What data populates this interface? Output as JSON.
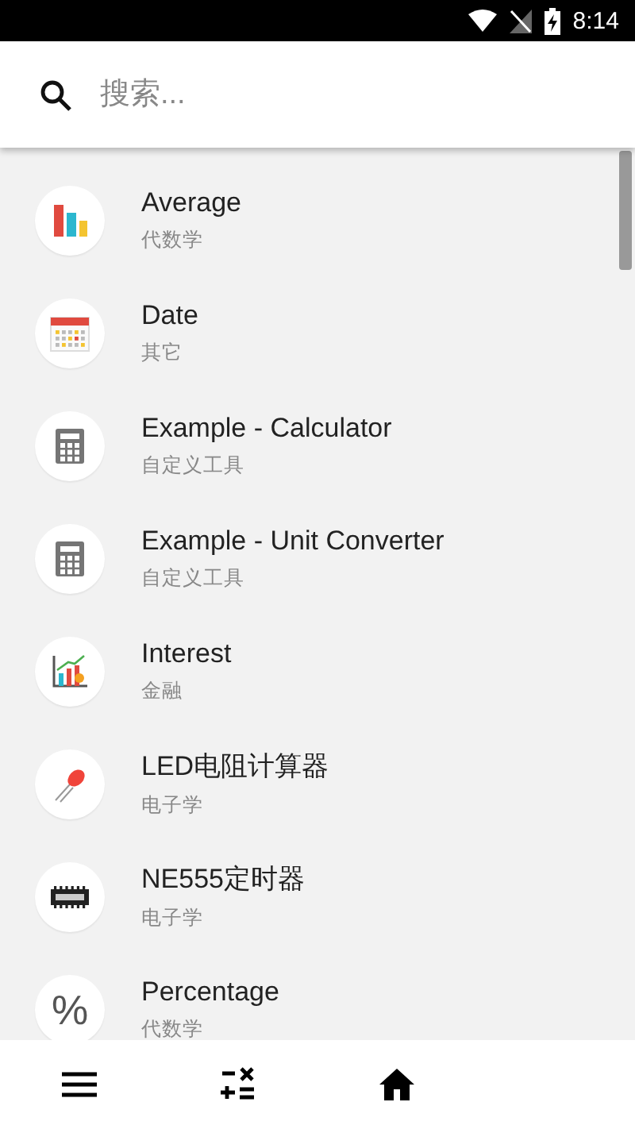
{
  "status_bar": {
    "time": "8:14"
  },
  "search": {
    "placeholder": "搜索..."
  },
  "items": [
    {
      "title": "Average",
      "category": "代数学",
      "kind": "bars"
    },
    {
      "title": "Date",
      "category": "其它",
      "kind": "calendar"
    },
    {
      "title": "Example - Calculator",
      "category": "自定义工具",
      "kind": "calculator"
    },
    {
      "title": "Example - Unit Converter",
      "category": "自定义工具",
      "kind": "calculator"
    },
    {
      "title": "Interest",
      "category": "金融",
      "kind": "chart"
    },
    {
      "title": "LED电阻计算器",
      "category": "电子学",
      "kind": "led"
    },
    {
      "title": "NE555定时器",
      "category": "电子学",
      "kind": "chip"
    },
    {
      "title": "Percentage",
      "category": "代数学",
      "kind": "glyph",
      "glyph": "%"
    }
  ],
  "bottom_nav": [
    {
      "kind": "menu"
    },
    {
      "kind": "calc"
    },
    {
      "kind": "home"
    }
  ]
}
